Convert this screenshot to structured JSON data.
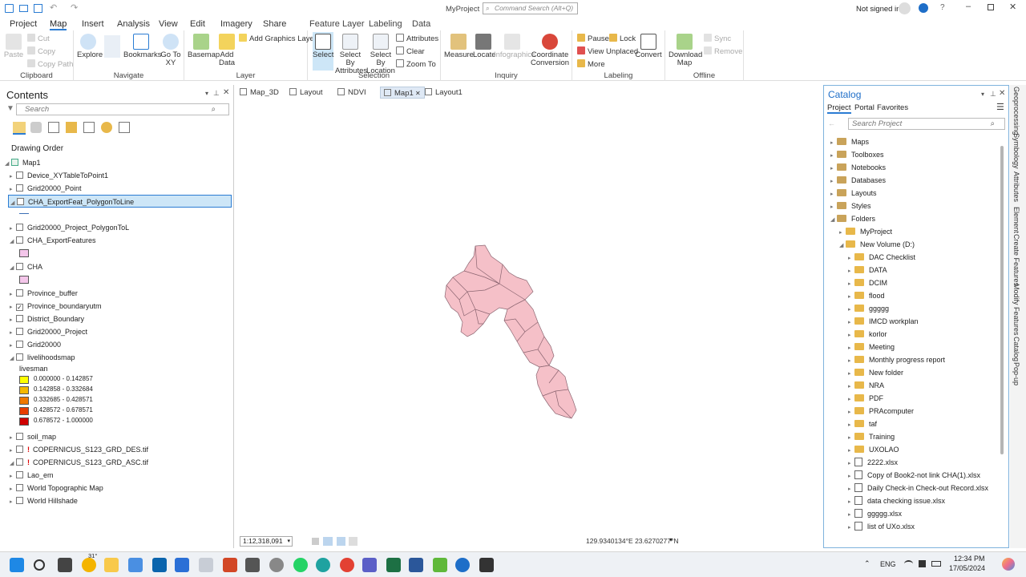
{
  "titlebar": {
    "title": "MyProject",
    "command_search_placeholder": "Command Search (Alt+Q)",
    "signin": "Not signed in"
  },
  "tabs": {
    "items": [
      "Project",
      "Map",
      "Insert",
      "Analysis",
      "View",
      "Edit",
      "Imagery",
      "Share"
    ],
    "active": "Map",
    "context_group": "Feature Layer",
    "context_tabs": [
      "Labeling",
      "Data"
    ]
  },
  "ribbon": {
    "clipboard": {
      "label": "Clipboard",
      "paste": "Paste",
      "cut": "Cut",
      "copy": "Copy",
      "copy_path": "Copy Path"
    },
    "navigate": {
      "label": "Navigate",
      "explore": "Explore",
      "bookmarks": "Bookmarks",
      "goto": "Go To XY"
    },
    "layer": {
      "label": "Layer",
      "basemap": "Basemap",
      "add_data": "Add Data",
      "add_graphics": "Add Graphics Layer"
    },
    "selection": {
      "label": "Selection",
      "select": "Select",
      "by_attr": "Select By Attributes",
      "by_loc": "Select By Location",
      "attributes": "Attributes",
      "clear": "Clear",
      "zoom_to": "Zoom To"
    },
    "inquiry": {
      "label": "Inquiry",
      "measure": "Measure",
      "locate": "Locate",
      "infographics": "Infographics",
      "coord": "Coordinate Conversion"
    },
    "labeling": {
      "label": "Labeling",
      "pause": "Pause",
      "lock": "Lock",
      "view_unplaced": "View Unplaced",
      "more": "More",
      "convert": "Convert"
    },
    "offline": {
      "label": "Offline",
      "download": "Download Map",
      "sync": "Sync",
      "remove": "Remove"
    }
  },
  "contents": {
    "title": "Contents",
    "search_placeholder": "Search",
    "drawing_order": "Drawing Order",
    "map_name": "Map1",
    "layers": [
      {
        "name": "Device_XYTableToPoint1",
        "checked": false,
        "expanded": false
      },
      {
        "name": "Grid20000_Point",
        "checked": false,
        "expanded": false
      },
      {
        "name": "CHA_ExportFeat_PolygonToLine",
        "checked": false,
        "expanded": true,
        "selected": true
      },
      {
        "name": "Grid20000_Project_PolygonToL",
        "checked": false,
        "expanded": false
      },
      {
        "name": "CHA_ExportFeatures",
        "checked": false,
        "expanded": true
      },
      {
        "name": "CHA",
        "checked": false,
        "expanded": true
      },
      {
        "name": "Province_buffer",
        "checked": false,
        "expanded": false
      },
      {
        "name": "Province_boundaryutm",
        "checked": true,
        "expanded": false
      },
      {
        "name": "District_Boundary",
        "checked": false,
        "expanded": false
      },
      {
        "name": "Grid20000_Project",
        "checked": false,
        "expanded": false
      },
      {
        "name": "Grid20000",
        "checked": false,
        "expanded": false
      },
      {
        "name": "livelihoodsmap",
        "checked": false,
        "expanded": true
      },
      {
        "name": "soil_map",
        "checked": false,
        "expanded": false
      },
      {
        "name": "COPERNICUS_S123_GRD_DES.tif",
        "checked": false,
        "expanded": false,
        "warning": true
      },
      {
        "name": "COPERNICUS_S123_GRD_ASC.tif",
        "checked": false,
        "expanded": true,
        "warning": true
      },
      {
        "name": "Lao_em",
        "checked": false,
        "expanded": false
      },
      {
        "name": "World Topographic Map",
        "checked": false,
        "expanded": false
      },
      {
        "name": "World Hillshade",
        "checked": false,
        "expanded": false
      }
    ],
    "legend_field": "livesman",
    "legend": [
      {
        "label": "0.000000 - 0.142857",
        "color": "#ffff00"
      },
      {
        "label": "0.142858 - 0.332684",
        "color": "#f5b800"
      },
      {
        "label": "0.332685 - 0.428571",
        "color": "#f07800"
      },
      {
        "label": "0.428572 - 0.678571",
        "color": "#e83c00"
      },
      {
        "label": "0.678572 - 1.000000",
        "color": "#d00000"
      }
    ],
    "cha_color": "#f4c6ea"
  },
  "view_tabs": [
    "Map_3D",
    "Layout",
    "NDVI",
    "Map1",
    "Layout1"
  ],
  "active_view": "Map1",
  "statusbar": {
    "scale": "1:12,318,091",
    "coords": "129.9340134°E 23.6270277°N"
  },
  "catalog": {
    "title": "Catalog",
    "tabs": [
      "Project",
      "Portal",
      "Favorites"
    ],
    "search_placeholder": "Search Project",
    "top_items": [
      "Maps",
      "Toolboxes",
      "Notebooks",
      "Databases",
      "Layouts",
      "Styles",
      "Folders"
    ],
    "folder_items": [
      "MyProject",
      "New Volume (D:)"
    ],
    "volume_items": [
      "DAC Checklist",
      "DATA",
      "DCIM",
      "flood",
      "ggggg",
      "IMCD workplan",
      "korlor",
      "Meeting",
      "Monthly progress report",
      "New folder",
      "NRA",
      "PDF",
      "PRAcomputer",
      "taf",
      "Training",
      "UXOLAO"
    ],
    "files": [
      "2222.xlsx",
      "Copy of Book2-not link CHA(1).xlsx",
      "Daily Check-in Check-out Record.xlsx",
      "data checking issue.xlsx",
      "ggggg.xlsx",
      "list of UXo.xlsx"
    ]
  },
  "right_strip": [
    "Geoprocessing",
    "Symbology",
    "Attributes",
    "Element",
    "Create Features",
    "Modify Features",
    "Catalog",
    "Pop-up"
  ],
  "taskbar": {
    "time": "12:34 PM",
    "date": "17/05/2024",
    "lang": "ENG",
    "weather": "31°"
  },
  "colors": {
    "accent": "#2b7cd3",
    "selection": "#cde6f7",
    "polygon_fill": "#f5c0c8"
  }
}
